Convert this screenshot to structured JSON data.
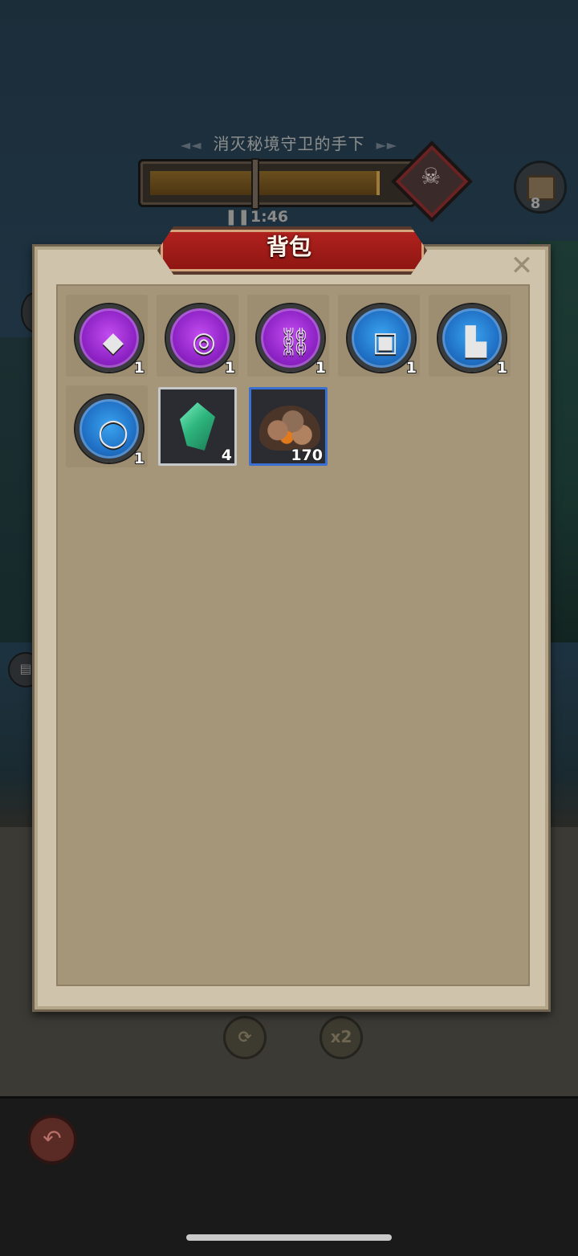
{
  "hud": {
    "quest_title": "消灭秘境守卫的手下",
    "timer": "1:46",
    "pause_icon": "pause-icon",
    "progress_fraction": 0.91,
    "chest_count": "8"
  },
  "panel": {
    "title": "背包",
    "close_symbol": "✕"
  },
  "inventory": [
    {
      "name": "pauldron",
      "rarity": "purple",
      "icon": "pauldron-icon",
      "glyph": "◆",
      "count": "1"
    },
    {
      "name": "bracer",
      "rarity": "purple",
      "icon": "bracer-icon",
      "glyph": "◎",
      "count": "1"
    },
    {
      "name": "necklace",
      "rarity": "purple",
      "icon": "chain-necklace-icon",
      "glyph": "⛓",
      "count": "1"
    },
    {
      "name": "helmet",
      "rarity": "blue",
      "icon": "helmet-icon",
      "glyph": "▣",
      "count": "1"
    },
    {
      "name": "boots",
      "rarity": "blue",
      "icon": "boots-icon",
      "glyph": "▙",
      "count": "1"
    },
    {
      "name": "ring",
      "rarity": "blue",
      "icon": "ring-icon",
      "glyph": "◯",
      "count": "1"
    },
    {
      "name": "emerald-crystal",
      "rarity": "gray",
      "icon": "crystal-icon",
      "count": "4"
    },
    {
      "name": "ore-pile",
      "rarity": "blue",
      "icon": "ore-icon",
      "count": "170"
    }
  ],
  "controls": {
    "refresh_symbol": "⟳",
    "speed_label": "x2",
    "back_symbol": "↶"
  },
  "colors": {
    "panel_bg": "#cfc3ab",
    "banner_red": "#b2231f",
    "rarity_purple": "#8d22c4",
    "rarity_blue": "#1f6fc4"
  }
}
